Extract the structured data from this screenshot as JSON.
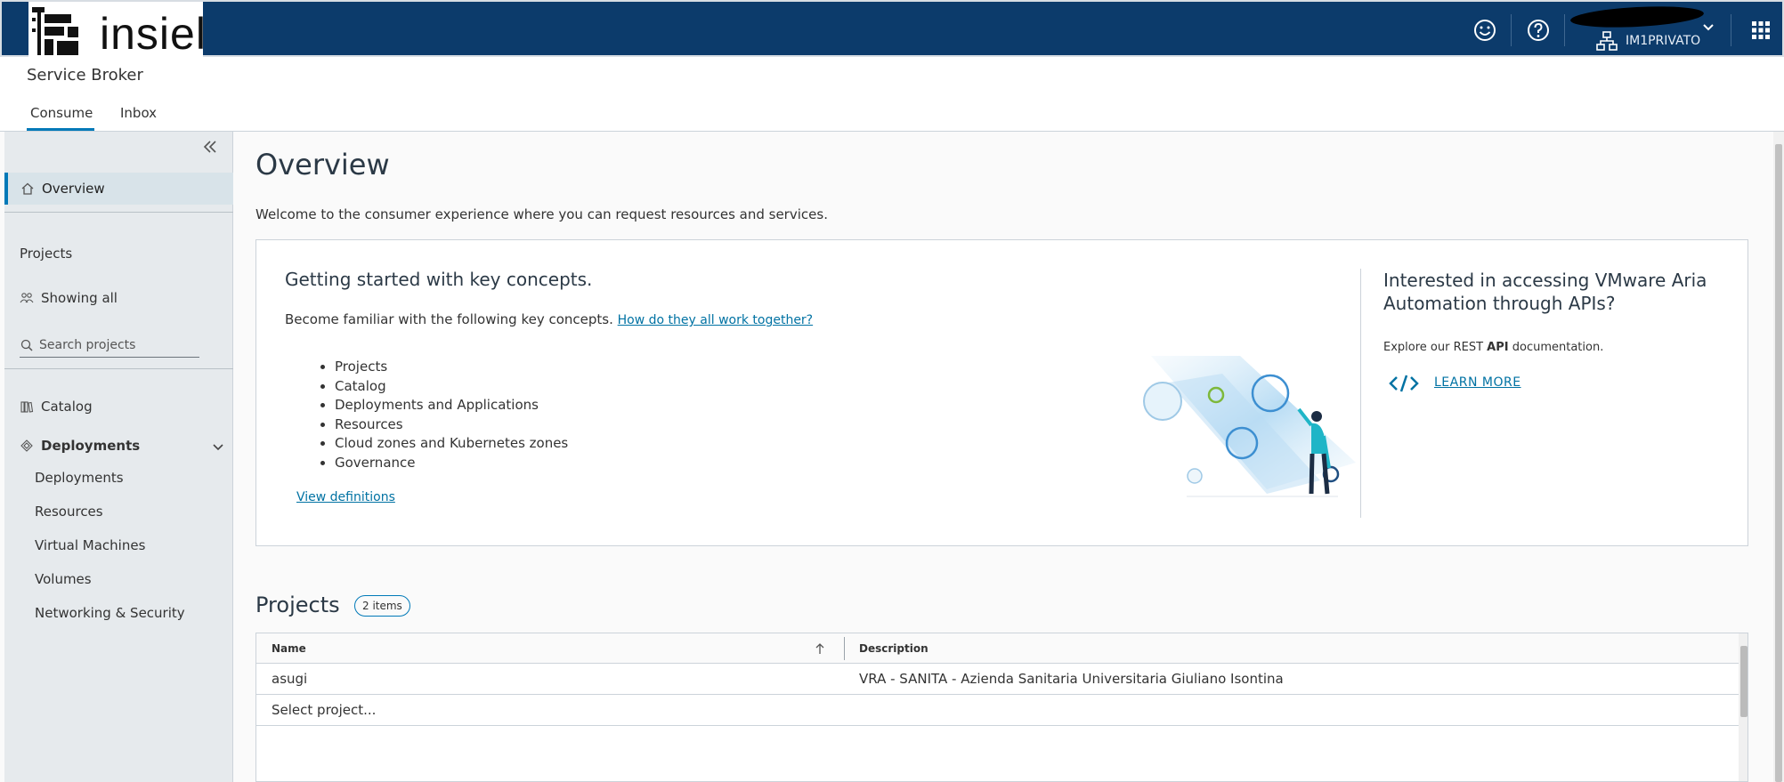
{
  "brand": {
    "logo_text": "insiel",
    "brand_color": "#0c3b6b",
    "accent_color": "#0079b8"
  },
  "header": {
    "icons": [
      "smiley-icon",
      "help-icon",
      "apps-grid-icon"
    ],
    "org_name": "IM1PRIVATO"
  },
  "app": {
    "title": "Service Broker",
    "tabs": [
      {
        "label": "Consume",
        "active": true
      },
      {
        "label": "Inbox",
        "active": false
      }
    ]
  },
  "sidebar": {
    "overview_label": "Overview",
    "projects_label": "Projects",
    "showing_all_label": "Showing all",
    "search_placeholder": "Search projects",
    "catalog_label": "Catalog",
    "deployments_label": "Deployments",
    "deployment_items": [
      "Deployments",
      "Resources",
      "Virtual Machines",
      "Volumes",
      "Networking & Security"
    ]
  },
  "main": {
    "title": "Overview",
    "welcome": "Welcome to the consumer experience where you can request resources and services.",
    "getting_started": {
      "title": "Getting started with key concepts.",
      "intro": "Become familiar with the following key concepts.",
      "intro_link": "How do they all work together?",
      "concepts": [
        "Projects",
        "Catalog",
        "Deployments and Applications",
        "Resources",
        "Cloud zones and Kubernetes zones",
        "Governance"
      ],
      "view_definitions": "View definitions"
    },
    "api": {
      "title": "Interested in accessing VMware Aria Automation through APIs?",
      "explore_prefix": "Explore our REST",
      "explore_bold": "API",
      "explore_suffix": "documentation.",
      "learn_more": "LEARN MORE"
    },
    "projects": {
      "title": "Projects",
      "count_badge": "2 items",
      "columns": [
        "Name",
        "Description"
      ],
      "rows": [
        {
          "name": "asugi",
          "description": "VRA - SANITA - Azienda Sanitaria Universitaria Giuliano Isontina"
        },
        {
          "name": "Select project...",
          "description": ""
        }
      ]
    }
  }
}
